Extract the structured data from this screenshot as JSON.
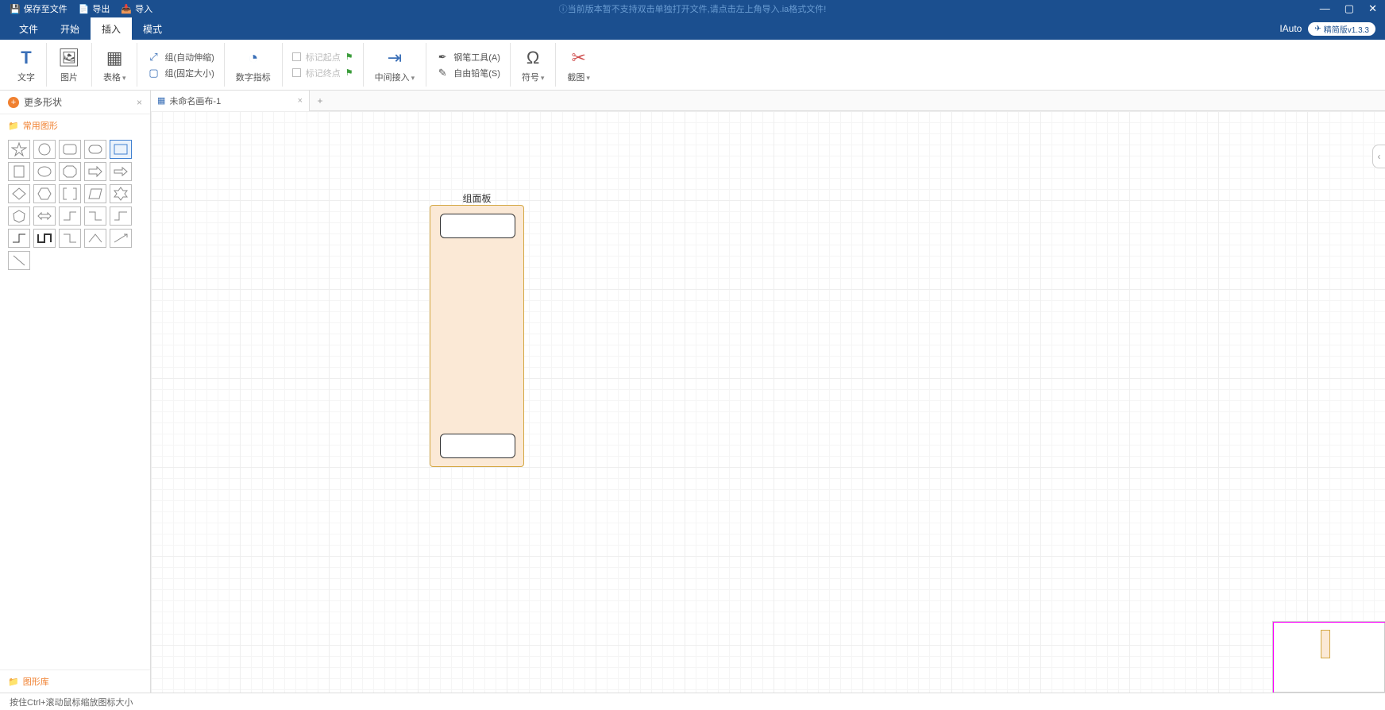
{
  "titlebar": {
    "save": "保存至文件",
    "export": "导出",
    "import": "导入",
    "warning": "ⓘ当前版本暂不支持双击单独打开文件,请点击左上角导入.ia格式文件!"
  },
  "menubar": {
    "items": [
      "文件",
      "开始",
      "插入",
      "模式"
    ],
    "active_index": 2,
    "brand": "IAuto",
    "badge": "精简版v1.3.3"
  },
  "ribbon": {
    "text": "文字",
    "image": "图片",
    "table": "表格",
    "group_auto": "组(自动伸缩)",
    "group_fixed": "组(固定大小)",
    "num_indicator": "数字指标",
    "mark_start": "标记起点",
    "mark_end": "标记终点",
    "mid_insert": "中间接入",
    "pen": "钢笔工具(A)",
    "free_pencil": "自由铅笔(S)",
    "symbol": "符号",
    "screenshot": "截图"
  },
  "sidebar": {
    "more_shapes": "更多形状",
    "sections": [
      "常用图形",
      "图形库"
    ]
  },
  "tabs": {
    "items": [
      {
        "label": "未命名画布-1"
      }
    ]
  },
  "canvas": {
    "panel_title": "组面板"
  },
  "status": {
    "hint": "按住Ctrl+滚动鼠标缩放图标大小"
  }
}
